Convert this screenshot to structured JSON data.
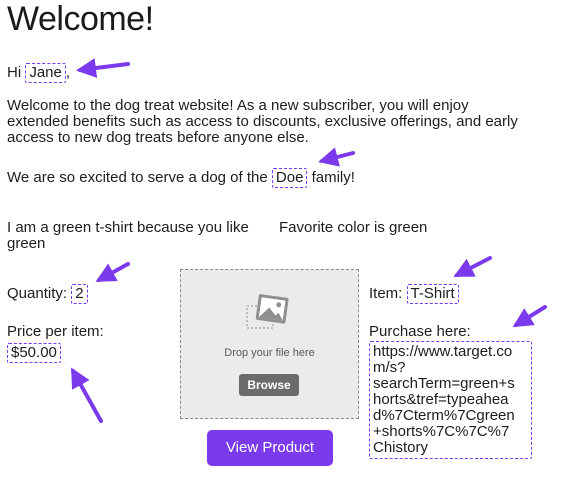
{
  "page": {
    "title": "Welcome!",
    "greeting_prefix": "Hi",
    "first_name": "Jane",
    "greeting_suffix": ",",
    "intro_text": "Welcome to the dog treat website! As a new subscriber, you will enjoy extended benefits such as access to discounts, exclusive offerings, and early access to new dog treats before anyone else.",
    "excited_prefix": "We are so excited to serve a dog of the",
    "family_name": "Doe",
    "excited_suffix": "family!",
    "shirt_text": "I am a green t-shirt because you like green",
    "favorite_text": "Favorite color is green"
  },
  "product": {
    "quantity_label": "Quantity:",
    "quantity_value": "2",
    "price_label": "Price per item:",
    "price_value": "$50.00",
    "item_label": "Item:",
    "item_value": "T-Shirt",
    "purchase_label": "Purchase here:",
    "purchase_url": "https://www.target.co\nm/s?\nsearchTerm=green+s\nhorts&tref=typeahea\nd%7Cterm%7Cgreen\n+shorts%7C%7C%7\nChistory",
    "view_button": "View Product"
  },
  "upload": {
    "drop_text": "Drop your file here",
    "browse_button": "Browse"
  },
  "colors": {
    "accent": "#7c3aed",
    "dropzone_bg": "#ebebeb",
    "browse_bg": "#6b6b6b"
  },
  "icons": [
    "image-placeholder-icon",
    "annotation-arrow-icon"
  ]
}
